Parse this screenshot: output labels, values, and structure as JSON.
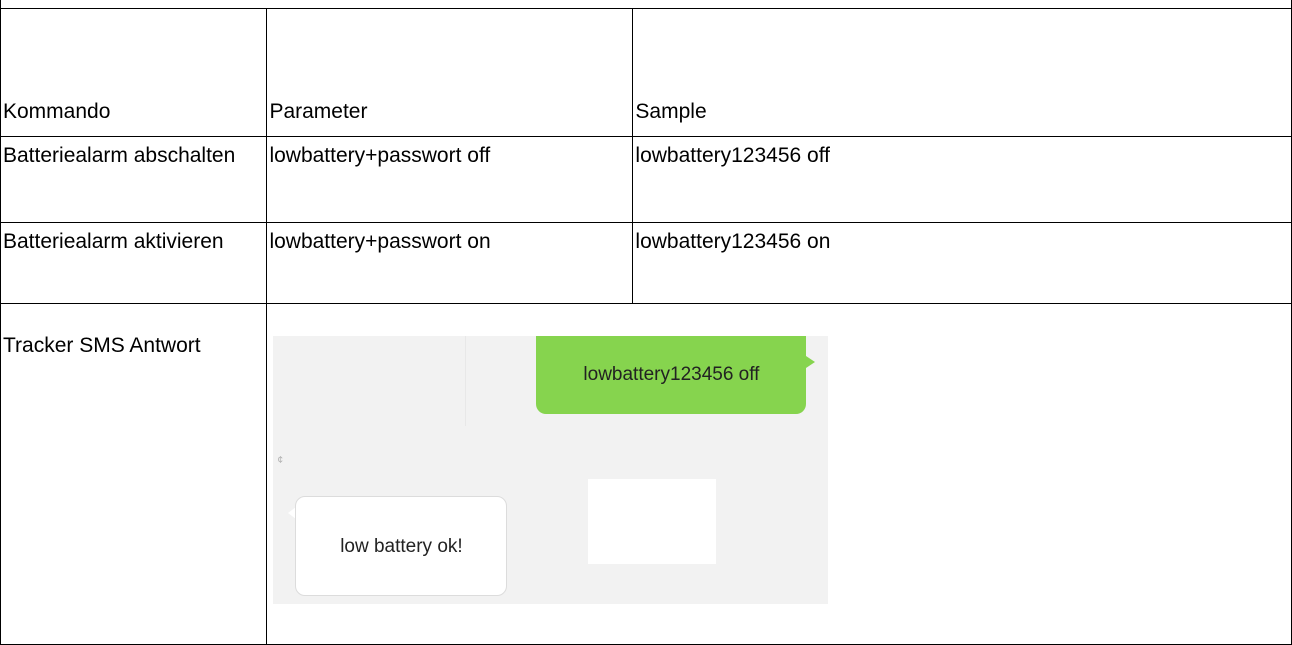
{
  "table": {
    "headers": {
      "command": "Kommando",
      "parameter": "Parameter",
      "sample": "Sample"
    },
    "rows": [
      {
        "command": "Batteriealarm abschalten",
        "parameter": "lowbattery+passwort off",
        "sample": "lowbattery123456  off"
      },
      {
        "command": "Batteriealarm aktivieren",
        "parameter": "lowbattery+passwort on",
        "sample": "lowbattery123456  on"
      }
    ],
    "sms_row": {
      "label": "Tracker SMS Antwort"
    }
  },
  "sms_screenshot": {
    "sent_message": "lowbattery123456 off",
    "received_message": "low battery ok!",
    "mark": "¢",
    "colors": {
      "sent_bubble": "#86d44e",
      "received_bubble": "#ffffff",
      "background": "#f2f2f2"
    }
  }
}
